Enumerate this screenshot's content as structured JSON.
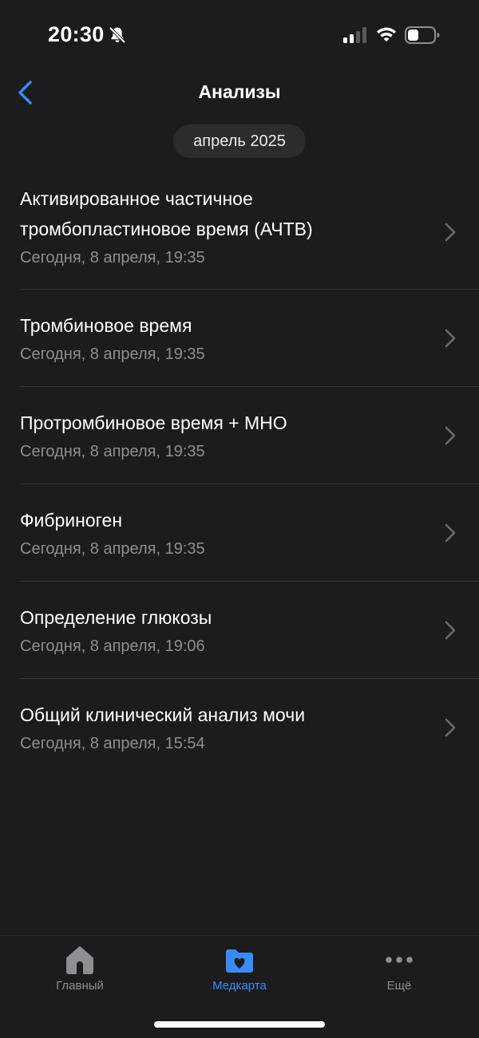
{
  "status_bar": {
    "time": "20:30"
  },
  "nav": {
    "title": "Анализы"
  },
  "month_label": "апрель 2025",
  "items": [
    {
      "title": "Активированное частичное тромбопластиновое время (АЧТВ)",
      "date": "Сегодня, 8 апреля, 19:35"
    },
    {
      "title": "Тромбиновое время",
      "date": "Сегодня, 8 апреля, 19:35"
    },
    {
      "title": "Протромбиновое время + МНО",
      "date": "Сегодня, 8 апреля, 19:35"
    },
    {
      "title": "Фибриноген",
      "date": "Сегодня, 8 апреля, 19:35"
    },
    {
      "title": "Определение глюкозы",
      "date": "Сегодня, 8 апреля, 19:06"
    },
    {
      "title": "Общий клинический анализ мочи",
      "date": "Сегодня, 8 апреля, 15:54"
    }
  ],
  "tabs": [
    {
      "label": "Главный",
      "icon": "house-icon",
      "active": false
    },
    {
      "label": "Медкарта",
      "icon": "folder-heart-icon",
      "active": true
    },
    {
      "label": "Ещё",
      "icon": "more-dots-icon",
      "active": false
    }
  ],
  "colors": {
    "background": "#1c1c1e",
    "accent": "#3a8cf5",
    "secondary_text": "#8e8e93",
    "inactive_tab": "#8e8e93"
  }
}
